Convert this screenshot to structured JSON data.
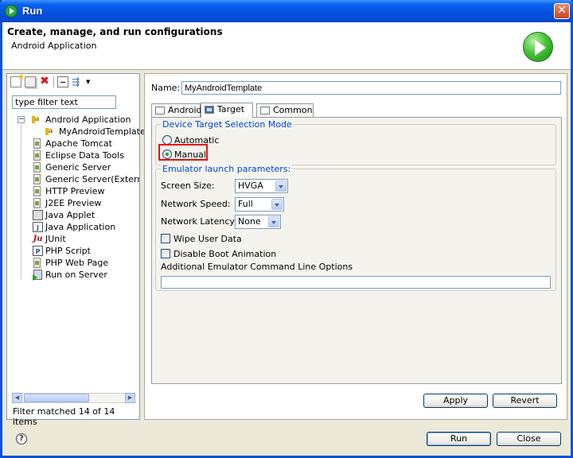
{
  "window": {
    "title": "Run"
  },
  "banner": {
    "title": "Create, manage, and run configurations",
    "subtitle": "Android Application"
  },
  "left": {
    "filter_placeholder": "type filter text",
    "filter_value": "type filter text",
    "tree": [
      {
        "label": "Android Application",
        "icon": "android-icon",
        "expanded": true
      },
      {
        "label": "MyAndroidTemplate",
        "icon": "android-icon",
        "child": true
      },
      {
        "label": "Apache Tomcat",
        "icon": "config-icon"
      },
      {
        "label": "Eclipse Data Tools",
        "icon": "config-icon"
      },
      {
        "label": "Generic Server",
        "icon": "config-icon"
      },
      {
        "label": "Generic Server(Externa",
        "icon": "config-icon"
      },
      {
        "label": "HTTP Preview",
        "icon": "config-icon"
      },
      {
        "label": "J2EE Preview",
        "icon": "config-icon"
      },
      {
        "label": "Java Applet",
        "icon": "applet-icon"
      },
      {
        "label": "Java Application",
        "icon": "java-app-icon"
      },
      {
        "label": "JUnit",
        "icon": "junit-icon"
      },
      {
        "label": "PHP Script",
        "icon": "php-icon"
      },
      {
        "label": "PHP Web Page",
        "icon": "config-icon"
      },
      {
        "label": "Run on Server",
        "icon": "server-icon"
      }
    ],
    "status": "Filter matched 14 of 14 items"
  },
  "right": {
    "name_label": "Name:",
    "name_value": "MyAndroidTemplate",
    "tabs": [
      {
        "label": "Android",
        "active": false
      },
      {
        "label": "Target",
        "active": true
      },
      {
        "label": "Common",
        "active": false
      }
    ],
    "device_group": {
      "title": "Device Target Selection Mode",
      "automatic_label": "Automatic",
      "manual_label": "Manual",
      "selected": "Manual"
    },
    "emulator_group": {
      "title": "Emulator launch parameters:",
      "screen_size_label": "Screen Size:",
      "screen_size_value": "HVGA",
      "network_speed_label": "Network Speed:",
      "network_speed_value": "Full",
      "network_latency_label": "Network Latency:",
      "network_latency_value": "None",
      "wipe_label": "Wipe User Data",
      "wipe_checked": false,
      "boot_anim_label": "Disable Boot Animation",
      "boot_anim_checked": false,
      "cmdline_label": "Additional Emulator Command Line Options",
      "cmdline_value": ""
    },
    "apply_label": "Apply",
    "revert_label": "Revert"
  },
  "footer": {
    "help": "?",
    "run_label": "Run",
    "close_label": "Close"
  },
  "colors": {
    "titlebar": "#0550dc",
    "group_title": "#0046d5",
    "highlight": "#e81010"
  }
}
